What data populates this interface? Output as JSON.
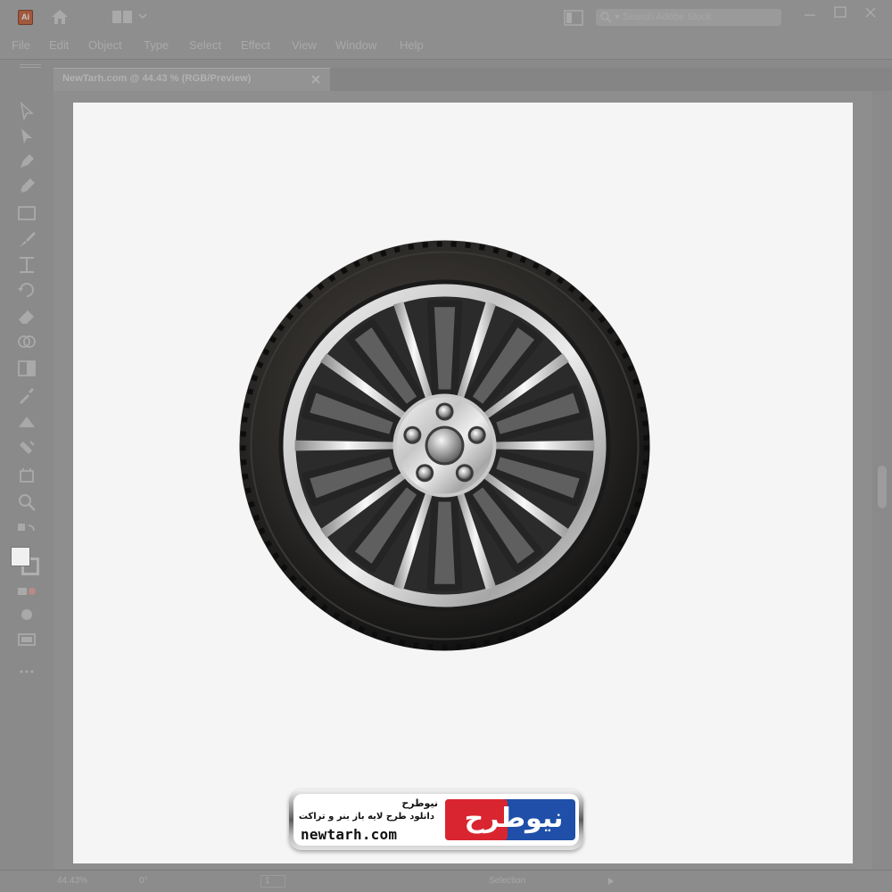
{
  "app": {
    "logo_text": "Ai",
    "search_placeholder": "Search Adobe Stock"
  },
  "menu": [
    "File",
    "Edit",
    "Object",
    "Type",
    "Select",
    "Effect",
    "View",
    "Window",
    "Help"
  ],
  "document_tab": {
    "title": "NewTarh.com @ 44.43 % (RGB/Preview)"
  },
  "tools": [
    "selection-tool-icon",
    "direct-selection-tool-icon",
    "pen-tool-icon",
    "curvature-tool-icon",
    "rectangle-tool-icon",
    "paintbrush-tool-icon",
    "width-tool-icon",
    "rotate-tool-icon",
    "eraser-tool-icon",
    "shape-builder-tool-icon",
    "gradient-tool-icon",
    "eyedropper-tool-icon",
    "blend-tool-icon",
    "symbol-sprayer-tool-icon",
    "artboard-tool-icon",
    "zoom-tool-icon"
  ],
  "status": {
    "zoom": "44.43%",
    "rotation": "0°",
    "page": "1",
    "tool": "Selection"
  },
  "watermark": {
    "logo_fa": "نیوطرح",
    "title": "نیوطرح",
    "subtitle": "دانلود طرح لایه باز بنر و تراکت",
    "url": "newtarh.com"
  },
  "colors": {
    "artboard": "#f5f5f5",
    "ui_overlay": "#8e8e8e",
    "tire": "#1f1f1f",
    "rim_silver": "#d9d9d9",
    "brand_red": "#d9252f",
    "brand_blue": "#1f4fa8"
  }
}
